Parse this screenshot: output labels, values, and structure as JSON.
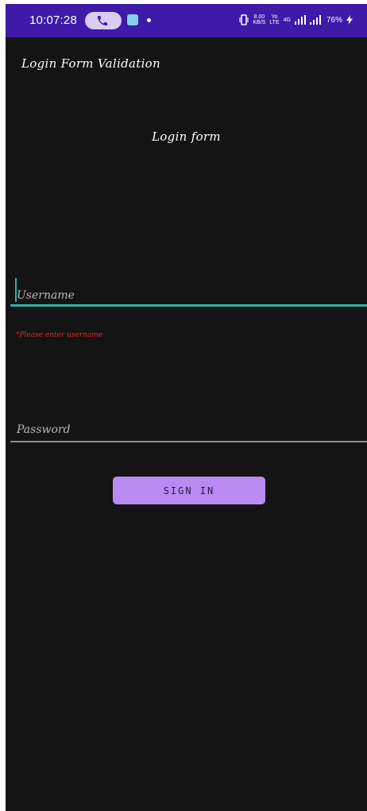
{
  "status_bar": {
    "time": "10:07:28",
    "speed_value": "8.00",
    "speed_unit": "KB/S",
    "net1": "Yo",
    "net1_sub": "LTE",
    "net2": "4G",
    "battery": "76%",
    "background_color": "#3d1ba8"
  },
  "app": {
    "title": "Login Form Validation",
    "background_color": "#141414"
  },
  "form": {
    "heading": "Login form",
    "username": {
      "placeholder": "Username",
      "value": "",
      "error": "*Please enter username",
      "accent_color": "#2ab5a4"
    },
    "password": {
      "placeholder": "Password",
      "value": ""
    },
    "sign_in_label": "SIGN IN",
    "button_color": "#b98af2",
    "error_color": "#e0281e"
  }
}
